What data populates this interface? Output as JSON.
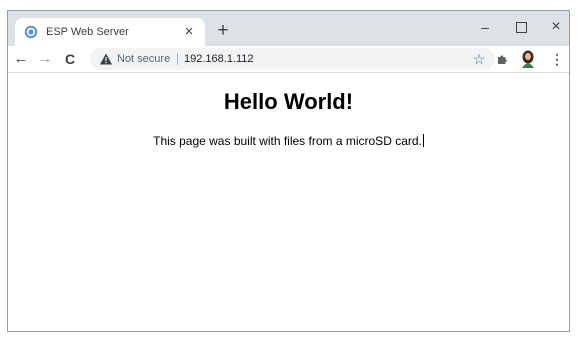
{
  "browser": {
    "tab": {
      "title": "ESP Web Server",
      "close_glyph": "×"
    },
    "new_tab_glyph": "+",
    "window_controls": {
      "minimize": "–",
      "close": "×"
    },
    "nav": {
      "back": "←",
      "forward": "→",
      "reload": "C"
    },
    "address_bar": {
      "security_label": "Not secure",
      "url": "192.168.1.112"
    },
    "icons": [
      "globe-icon",
      "warning-icon",
      "star-icon",
      "puzzle-icon",
      "avatar",
      "kebab-menu-icon"
    ],
    "star_glyph": "☆",
    "menu_glyph": "⋮"
  },
  "page": {
    "heading": "Hello World!",
    "paragraph": "This page was built with files from a microSD card."
  },
  "colors": {
    "titlebar": "#dee1e6",
    "omnibox": "#f1f3f4",
    "tab_favicon": "#5b8fd6"
  }
}
